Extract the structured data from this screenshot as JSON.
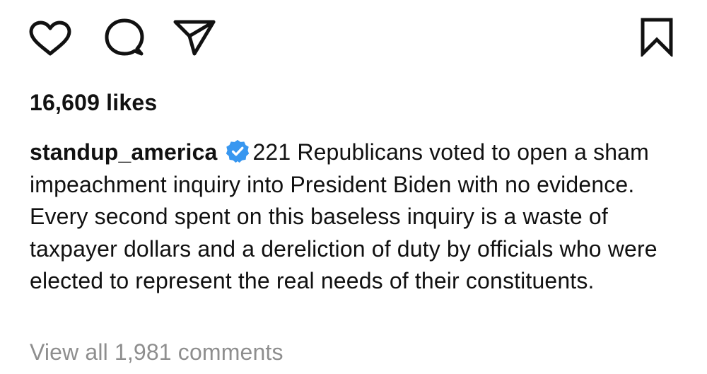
{
  "post": {
    "actions": {
      "like_icon": "heart-icon",
      "comment_icon": "comment-icon",
      "share_icon": "paper-plane-icon",
      "save_icon": "bookmark-icon"
    },
    "likes_text": "16,609 likes",
    "caption": {
      "username": "standup_america",
      "verified_icon": "verified-badge-icon",
      "text": "221 Republicans voted to open a sham impeachment inquiry into President Biden with no evidence. Every second spent on this baseless inquiry is a waste of taxpayer dollars and a dereliction of duty by officials who were elected to represent the real needs of their constituents."
    },
    "view_comments_text": "View all 1,981 comments"
  },
  "colors": {
    "text": "#111111",
    "muted": "#8e8e8e",
    "verified_blue": "#3897f0",
    "background": "#ffffff"
  }
}
